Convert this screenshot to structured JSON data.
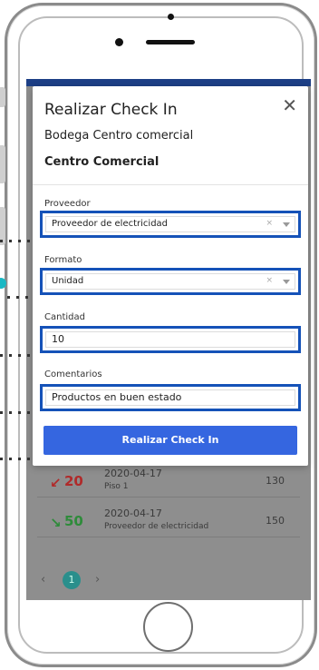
{
  "modal": {
    "title": "Realizar Check In",
    "close_icon": "close-icon",
    "warehouse": "Bodega Centro comercial",
    "location": "Centro Comercial",
    "fields": {
      "provider_label": "Proveedor",
      "provider_value": "Proveedor de electricidad",
      "format_label": "Formato",
      "format_value": "Unidad",
      "quantity_label": "Cantidad",
      "quantity_value": "10",
      "comments_label": "Comentarios",
      "comments_value": "Productos en buen estado"
    },
    "clear_glyph": "×",
    "submit_label": "Realizar Check In",
    "accent_color": "#1552b8",
    "button_color": "#3566e0"
  },
  "background_list": [
    {
      "direction": "down-left",
      "arrow": "↙",
      "qty": "20",
      "qty_color": "#b02a2a",
      "date": "2020-04-17",
      "subtitle": "Piso 1",
      "value": "130"
    },
    {
      "direction": "down-right",
      "arrow": "↘",
      "qty": "50",
      "qty_color": "#2e8b3a",
      "date": "2020-04-17",
      "subtitle": "Proveedor de electricidad",
      "value": "150"
    }
  ],
  "pager": {
    "prev": "‹",
    "current": "1",
    "next": "›"
  }
}
